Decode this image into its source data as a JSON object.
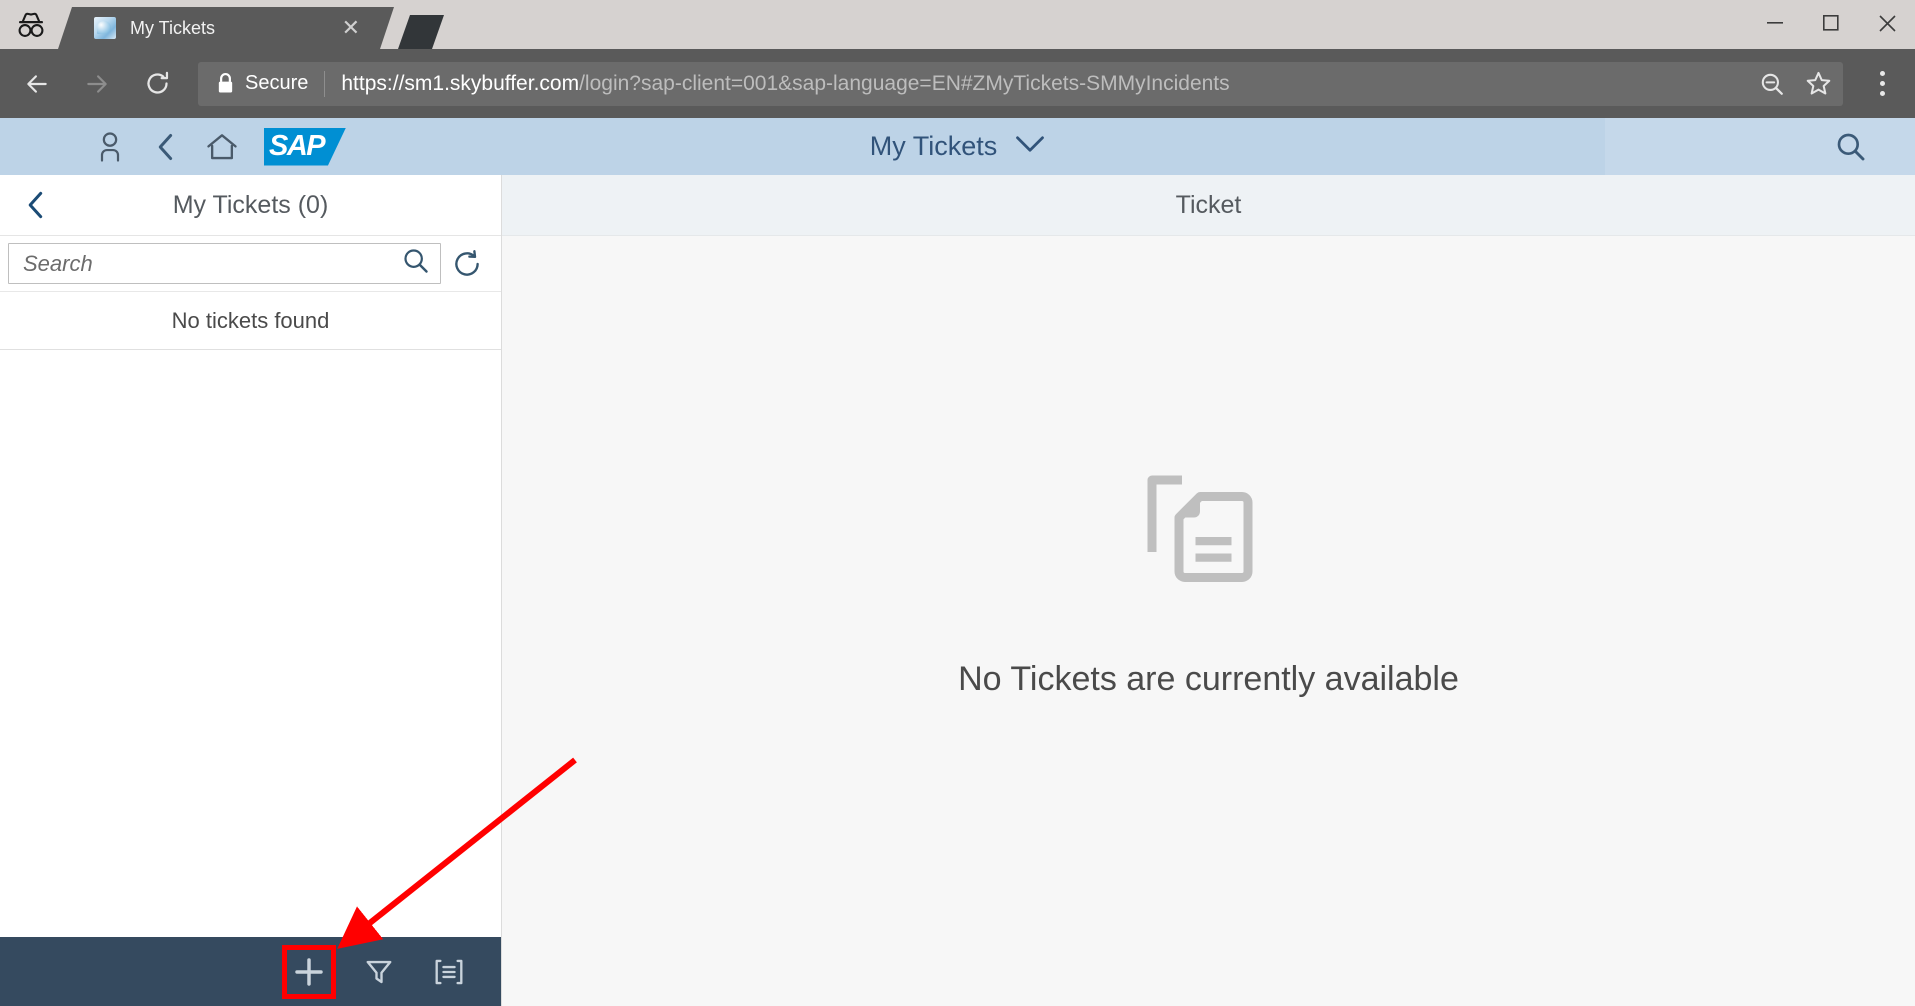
{
  "browser": {
    "incognito_icon": "incognito-icon",
    "tab": {
      "title": "My Tickets",
      "favicon": "page-favicon",
      "close_icon": "close-icon"
    },
    "new_tab_icon": "new-tab-icon",
    "window_controls": {
      "minimize": "minimize-icon",
      "maximize": "maximize-icon",
      "close": "close-icon"
    },
    "nav": {
      "back_icon": "back-arrow-icon",
      "forward_icon": "forward-arrow-icon",
      "reload_icon": "reload-icon"
    },
    "omnibox": {
      "lock_icon": "lock-icon",
      "security_label": "Secure",
      "url_scheme_host": "https://sm1.skybuffer.com",
      "url_path": "/login?sap-client=001&sap-language=EN#ZMyTickets-SMMyIncidents",
      "zoom_out_icon": "zoom-out-icon",
      "bookmark_icon": "star-icon"
    },
    "menu_icon": "kebab-menu-icon"
  },
  "shellbar": {
    "user_icon": "user-icon",
    "back_icon": "chevron-left-icon",
    "home_icon": "home-icon",
    "logo_text": "SAP",
    "title": "My Tickets",
    "title_chevron_icon": "chevron-down-icon",
    "search_icon": "search-icon",
    "background_color": "#bdd3e7",
    "title_color": "#31537a",
    "logo_color": "#008fd3"
  },
  "master": {
    "back_icon": "chevron-left-icon",
    "title": "My Tickets (0)",
    "search": {
      "placeholder": "Search",
      "value": "",
      "search_icon": "search-icon",
      "refresh_icon": "refresh-icon"
    },
    "empty_list_text": "No tickets found",
    "footer": {
      "background_color": "#354a5f",
      "buttons": [
        {
          "name": "add-button",
          "icon": "plus-icon",
          "label": "Create",
          "highlighted": true
        },
        {
          "name": "filter-button",
          "icon": "filter-icon",
          "label": "Filter",
          "highlighted": false
        },
        {
          "name": "group-button",
          "icon": "group-icon",
          "label": "Group",
          "highlighted": false
        }
      ]
    }
  },
  "detail": {
    "header_title": "Ticket",
    "placeholder_icon": "document-copy-icon",
    "placeholder_text": "No Tickets are currently available"
  },
  "annotation": {
    "arrow_color": "#ff0000",
    "highlight_color": "#ff0000"
  }
}
